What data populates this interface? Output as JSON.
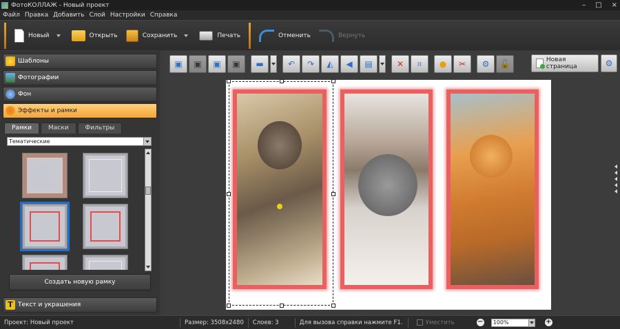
{
  "window": {
    "title": "ФотоКОЛЛАЖ - Новый проект",
    "controls": [
      "–",
      "□",
      "×"
    ]
  },
  "menu": [
    "Файл",
    "Правка",
    "Добавить",
    "Слой",
    "Настройки",
    "Справка"
  ],
  "toolbar": {
    "new_label": "Новый",
    "open_label": "Открыть",
    "save_label": "Сохранить",
    "print_label": "Печать",
    "undo_label": "Отменить",
    "redo_label": "Вернуть"
  },
  "sidebar": {
    "sections": [
      {
        "label": "Шаблоны",
        "icon": "star-icon",
        "active": false
      },
      {
        "label": "Фотографии",
        "icon": "photo-icon",
        "active": false
      },
      {
        "label": "Фон",
        "icon": "background-icon",
        "active": false
      },
      {
        "label": "Эффекты и рамки",
        "icon": "palette-icon",
        "active": true
      }
    ],
    "tabs": [
      "Рамки",
      "Маски",
      "Фильтры"
    ],
    "active_tab": "Рамки",
    "category_select": "Тематические",
    "create_frame_label": "Создать новую рамку",
    "text_section_label": "Текст и украшения"
  },
  "canvas": {
    "new_page_label": "Новая страница",
    "accent_color": "#e86060",
    "selection_color": "#1e6fd0"
  },
  "status": {
    "project_label": "Проект:",
    "project_name": "Новый проект",
    "size_label": "Размер:",
    "size_value": "3508x2480",
    "layers_label": "Слоев:",
    "layers_value": "3",
    "help_text": "Для вызова справки нажмите F1.",
    "fit_label": "Уместить",
    "zoom_value": "100%"
  }
}
